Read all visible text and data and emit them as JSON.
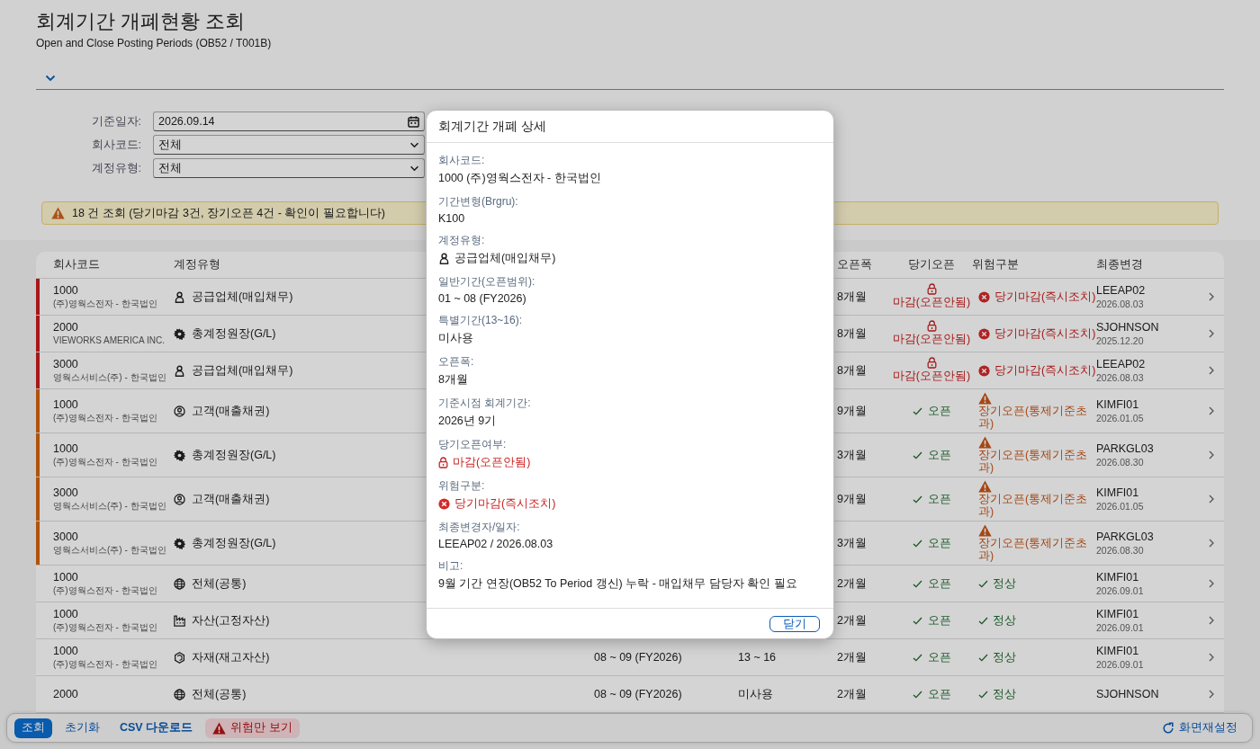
{
  "page": {
    "title": "회계기간 개폐현황 조회",
    "subtitle": "Open and Close Posting Periods (OB52 / T001B)"
  },
  "filters": [
    {
      "label": "기준일자:",
      "value": "2026.09.14",
      "kind": "date"
    },
    {
      "label": "회사코드:",
      "value": "전체",
      "kind": "select"
    },
    {
      "label": "계정유형:",
      "value": "전체",
      "kind": "select"
    }
  ],
  "message": {
    "text": "18 건 조회 (당기마감 3건, 장기오픈 4건 - 확인이 필요합니다)"
  },
  "table": {
    "columns": [
      "회사코드",
      "계정유형",
      "오픈폭",
      "당기오픈",
      "위험구분",
      "최종변경"
    ],
    "rows": [
      {
        "company_code": "1000",
        "company_name": "(주)영웍스전자 - 한국법인",
        "account_type": {
          "kind": "vendor",
          "label": "공급업체(매입채무)"
        },
        "open_width": "8개월",
        "current_open": {
          "kind": "closed",
          "label": "마감(오픈안됨)"
        },
        "risk": {
          "kind": "closed",
          "label": "당기마감(즉시조치)"
        },
        "changed_by": "LEEAP02",
        "changed_date": "2026.08.03"
      },
      {
        "company_code": "2000",
        "company_name": "VIEWORKS AMERICA INC.",
        "account_type": {
          "kind": "gl",
          "label": "총계정원장(G/L)"
        },
        "open_width": "8개월",
        "current_open": {
          "kind": "closed",
          "label": "마감(오픈안됨)"
        },
        "risk": {
          "kind": "closed",
          "label": "당기마감(즉시조치)"
        },
        "changed_by": "SJOHNSON",
        "changed_date": "2025.12.20"
      },
      {
        "company_code": "3000",
        "company_name": "영웍스서비스(주) - 한국법인",
        "account_type": {
          "kind": "vendor",
          "label": "공급업체(매입채무)"
        },
        "open_width": "8개월",
        "current_open": {
          "kind": "closed",
          "label": "마감(오픈안됨)"
        },
        "risk": {
          "kind": "closed",
          "label": "당기마감(즉시조치)"
        },
        "changed_by": "LEEAP02",
        "changed_date": "2026.08.03"
      },
      {
        "company_code": "1000",
        "company_name": "(주)영웍스전자 - 한국법인",
        "account_type": {
          "kind": "customer",
          "label": "고객(매출채권)"
        },
        "open_width": "9개월",
        "current_open": {
          "kind": "open",
          "label": "오픈"
        },
        "risk": {
          "kind": "long_open",
          "label": "장기오픈(통제기준초과)"
        },
        "changed_by": "KIMFI01",
        "changed_date": "2026.01.05"
      },
      {
        "company_code": "1000",
        "company_name": "(주)영웍스전자 - 한국법인",
        "account_type": {
          "kind": "gl",
          "label": "총계정원장(G/L)"
        },
        "open_width": "3개월",
        "current_open": {
          "kind": "open",
          "label": "오픈"
        },
        "risk": {
          "kind": "long_open",
          "label": "장기오픈(통제기준초과)"
        },
        "changed_by": "PARKGL03",
        "changed_date": "2026.08.30"
      },
      {
        "company_code": "3000",
        "company_name": "영웍스서비스(주) - 한국법인",
        "account_type": {
          "kind": "customer",
          "label": "고객(매출채권)"
        },
        "open_width": "9개월",
        "current_open": {
          "kind": "open",
          "label": "오픈"
        },
        "risk": {
          "kind": "long_open",
          "label": "장기오픈(통제기준초과)"
        },
        "changed_by": "KIMFI01",
        "changed_date": "2026.01.05"
      },
      {
        "company_code": "3000",
        "company_name": "영웍스서비스(주) - 한국법인",
        "account_type": {
          "kind": "gl",
          "label": "총계정원장(G/L)"
        },
        "open_width": "3개월",
        "current_open": {
          "kind": "open",
          "label": "오픈"
        },
        "risk": {
          "kind": "long_open",
          "label": "장기오픈(통제기준초과)"
        },
        "changed_by": "PARKGL03",
        "changed_date": "2026.08.30"
      },
      {
        "company_code": "1000",
        "company_name": "(주)영웍스전자 - 한국법인",
        "account_type": {
          "kind": "all",
          "label": "전체(공통)"
        },
        "open_width": "2개월",
        "current_open": {
          "kind": "open",
          "label": "오픈"
        },
        "risk": {
          "kind": "normal",
          "label": "정상"
        },
        "changed_by": "KIMFI01",
        "changed_date": "2026.09.01"
      },
      {
        "company_code": "1000",
        "company_name": "(주)영웍스전자 - 한국법인",
        "account_type": {
          "kind": "asset",
          "label": "자산(고정자산)"
        },
        "open_width": "2개월",
        "current_open": {
          "kind": "open",
          "label": "오픈"
        },
        "risk": {
          "kind": "normal",
          "label": "정상"
        },
        "changed_by": "KIMFI01",
        "changed_date": "2026.09.01"
      },
      {
        "company_code": "1000",
        "company_name": "(주)영웍스전자 - 한국법인",
        "account_type": {
          "kind": "material",
          "label": "자재(재고자산)"
        },
        "period": "08 ~ 09 (FY2026)",
        "special": "13 ~ 16",
        "open_width": "2개월",
        "current_open": {
          "kind": "open",
          "label": "오픈"
        },
        "risk": {
          "kind": "normal",
          "label": "정상"
        },
        "changed_by": "KIMFI01",
        "changed_date": "2026.09.01"
      },
      {
        "company_code": "2000",
        "account_type": {
          "kind": "all",
          "label": "전체(공통)"
        },
        "period": "08 ~ 09 (FY2026)",
        "special": "미사용",
        "open_width": "2개월",
        "current_open": {
          "kind": "open",
          "label": "오픈"
        },
        "risk": {
          "kind": "normal",
          "label": "정상"
        },
        "changed_by": "SJOHNSON"
      }
    ]
  },
  "toolbar": {
    "buttons": [
      {
        "label": "조회",
        "kind": "primary"
      },
      {
        "label": "초기화",
        "kind": "link"
      },
      {
        "label": "CSV 다운로드",
        "kind": "emphasized"
      },
      {
        "label": "위험만 보기",
        "kind": "danger"
      }
    ],
    "reset": {
      "label": "화면재설정"
    }
  },
  "dialog": {
    "title": "회계기간 개폐 상세",
    "fields": [
      {
        "label": "회사코드:",
        "value": "1000 (주)영웍스전자 - 한국법인",
        "kind": "text"
      },
      {
        "label": "기간변형(Brgru):",
        "value": "K100",
        "kind": "text"
      },
      {
        "label": "계정유형:",
        "value": "공급업체(매입채무)",
        "kind": "vendor"
      },
      {
        "label": "일반기간(오픈범위):",
        "value": "01 ~ 08 (FY2026)",
        "kind": "text"
      },
      {
        "label": "특별기간(13~16):",
        "value": "미사용",
        "kind": "text"
      },
      {
        "label": "오픈폭:",
        "value": "8개월",
        "kind": "text"
      },
      {
        "label": "기준시점 회계기간:",
        "value": "2026년 9기",
        "kind": "text"
      },
      {
        "label": "당기오픈여부:",
        "value": "마감(오픈안됨)",
        "kind": "closed"
      },
      {
        "label": "위험구분:",
        "value": "당기마감(즉시조치)",
        "kind": "critical"
      },
      {
        "label": "최종변경자/일자:",
        "value": "LEEAP02 / 2026.08.03",
        "kind": "text"
      },
      {
        "label": "비고:",
        "value": "9월 기간 연장(OB52 To Period 갱신) 누락 - 매입채무 담당자 확인 필요",
        "kind": "text"
      }
    ],
    "close_label": "닫기"
  }
}
